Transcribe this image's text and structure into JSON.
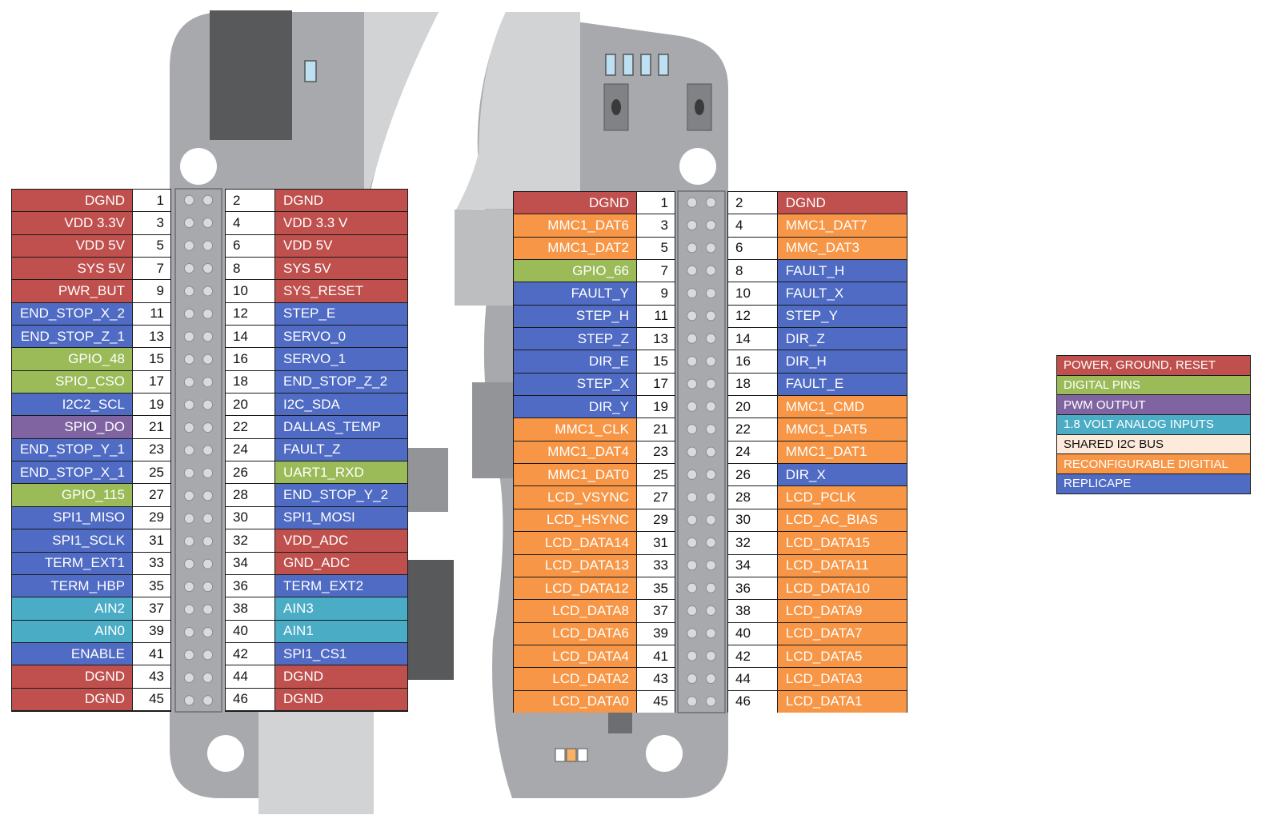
{
  "colors": {
    "power": "#c0504d",
    "digital": "#9bbb59",
    "pwm": "#8064a2",
    "analog": "#4bacc6",
    "i2c": "#fdeada",
    "reconfig": "#f79646",
    "replicape": "#4f6bc4"
  },
  "legend": [
    {
      "label": "POWER, GROUND, RESET",
      "cat": "power"
    },
    {
      "label": "DIGITAL PINS",
      "cat": "digital"
    },
    {
      "label": "PWM OUTPUT",
      "cat": "pwm"
    },
    {
      "label": "1.8 VOLT ANALOG INPUTS",
      "cat": "analog"
    },
    {
      "label": "SHARED I2C BUS",
      "cat": "i2c"
    },
    {
      "label": "RECONFIGURABLE DIGITIAL",
      "cat": "reconfig"
    },
    {
      "label": "REPLICAPE",
      "cat": "replicape"
    }
  ],
  "p9": {
    "odd": [
      {
        "label": "DGND",
        "pin": "1",
        "cat": "power"
      },
      {
        "label": "VDD 3.3V",
        "pin": "3",
        "cat": "power"
      },
      {
        "label": "VDD 5V",
        "pin": "5",
        "cat": "power"
      },
      {
        "label": "SYS 5V",
        "pin": "7",
        "cat": "power"
      },
      {
        "label": "PWR_BUT",
        "pin": "9",
        "cat": "power"
      },
      {
        "label": "END_STOP_X_2",
        "pin": "11",
        "cat": "replicape"
      },
      {
        "label": "END_STOP_Z_1",
        "pin": "13",
        "cat": "replicape"
      },
      {
        "label": "GPIO_48",
        "pin": "15",
        "cat": "digital"
      },
      {
        "label": "SPIO_CSO",
        "pin": "17",
        "cat": "digital"
      },
      {
        "label": "I2C2_SCL",
        "pin": "19",
        "cat": "replicape"
      },
      {
        "label": "SPIO_DO",
        "pin": "21",
        "cat": "pwm"
      },
      {
        "label": "END_STOP_Y_1",
        "pin": "23",
        "cat": "replicape"
      },
      {
        "label": "END_STOP_X_1",
        "pin": "25",
        "cat": "replicape"
      },
      {
        "label": "GPIO_115",
        "pin": "27",
        "cat": "digital"
      },
      {
        "label": "SPI1_MISO",
        "pin": "29",
        "cat": "replicape"
      },
      {
        "label": "SPI1_SCLK",
        "pin": "31",
        "cat": "replicape"
      },
      {
        "label": "TERM_EXT1",
        "pin": "33",
        "cat": "replicape"
      },
      {
        "label": "TERM_HBP",
        "pin": "35",
        "cat": "replicape"
      },
      {
        "label": "AIN2",
        "pin": "37",
        "cat": "analog"
      },
      {
        "label": "AIN0",
        "pin": "39",
        "cat": "analog"
      },
      {
        "label": "ENABLE",
        "pin": "41",
        "cat": "replicape"
      },
      {
        "label": "DGND",
        "pin": "43",
        "cat": "power"
      },
      {
        "label": "DGND",
        "pin": "45",
        "cat": "power"
      }
    ],
    "even": [
      {
        "label": "DGND",
        "pin": "2",
        "cat": "power"
      },
      {
        "label": "VDD 3.3 V",
        "pin": "4",
        "cat": "power"
      },
      {
        "label": "VDD 5V",
        "pin": "6",
        "cat": "power"
      },
      {
        "label": "SYS 5V",
        "pin": "8",
        "cat": "power"
      },
      {
        "label": "SYS_RESET",
        "pin": "10",
        "cat": "power"
      },
      {
        "label": "STEP_E",
        "pin": "12",
        "cat": "replicape"
      },
      {
        "label": "SERVO_0",
        "pin": "14",
        "cat": "replicape"
      },
      {
        "label": "SERVO_1",
        "pin": "16",
        "cat": "replicape"
      },
      {
        "label": "END_STOP_Z_2",
        "pin": "18",
        "cat": "replicape"
      },
      {
        "label": "I2C_SDA",
        "pin": "20",
        "cat": "replicape"
      },
      {
        "label": "DALLAS_TEMP",
        "pin": "22",
        "cat": "replicape"
      },
      {
        "label": "FAULT_Z",
        "pin": "24",
        "cat": "replicape"
      },
      {
        "label": "UART1_RXD",
        "pin": "26",
        "cat": "digital"
      },
      {
        "label": "END_STOP_Y_2",
        "pin": "28",
        "cat": "replicape"
      },
      {
        "label": "SPI1_MOSI",
        "pin": "30",
        "cat": "replicape"
      },
      {
        "label": "VDD_ADC",
        "pin": "32",
        "cat": "power"
      },
      {
        "label": "GND_ADC",
        "pin": "34",
        "cat": "power"
      },
      {
        "label": "TERM_EXT2",
        "pin": "36",
        "cat": "replicape"
      },
      {
        "label": "AIN3",
        "pin": "38",
        "cat": "analog"
      },
      {
        "label": "AIN1",
        "pin": "40",
        "cat": "analog"
      },
      {
        "label": "SPI1_CS1",
        "pin": "42",
        "cat": "replicape"
      },
      {
        "label": "DGND",
        "pin": "44",
        "cat": "power"
      },
      {
        "label": "DGND",
        "pin": "46",
        "cat": "power"
      }
    ]
  },
  "p8": {
    "odd": [
      {
        "label": "DGND",
        "pin": "1",
        "cat": "power"
      },
      {
        "label": "MMC1_DAT6",
        "pin": "3",
        "cat": "reconfig"
      },
      {
        "label": "MMC1_DAT2",
        "pin": "5",
        "cat": "reconfig"
      },
      {
        "label": "GPIO_66",
        "pin": "7",
        "cat": "digital"
      },
      {
        "label": "FAULT_Y",
        "pin": "9",
        "cat": "replicape"
      },
      {
        "label": "STEP_H",
        "pin": "11",
        "cat": "replicape"
      },
      {
        "label": "STEP_Z",
        "pin": "13",
        "cat": "replicape"
      },
      {
        "label": "DIR_E",
        "pin": "15",
        "cat": "replicape"
      },
      {
        "label": "STEP_X",
        "pin": "17",
        "cat": "replicape"
      },
      {
        "label": "DIR_Y",
        "pin": "19",
        "cat": "replicape"
      },
      {
        "label": "MMC1_CLK",
        "pin": "21",
        "cat": "reconfig"
      },
      {
        "label": "MMC1_DAT4",
        "pin": "23",
        "cat": "reconfig"
      },
      {
        "label": "MMC1_DAT0",
        "pin": "25",
        "cat": "reconfig"
      },
      {
        "label": "LCD_VSYNC",
        "pin": "27",
        "cat": "reconfig"
      },
      {
        "label": "LCD_HSYNC",
        "pin": "29",
        "cat": "reconfig"
      },
      {
        "label": "LCD_DATA14",
        "pin": "31",
        "cat": "reconfig"
      },
      {
        "label": "LCD_DATA13",
        "pin": "33",
        "cat": "reconfig"
      },
      {
        "label": "LCD_DATA12",
        "pin": "35",
        "cat": "reconfig"
      },
      {
        "label": "LCD_DATA8",
        "pin": "37",
        "cat": "reconfig"
      },
      {
        "label": "LCD_DATA6",
        "pin": "39",
        "cat": "reconfig"
      },
      {
        "label": "LCD_DATA4",
        "pin": "41",
        "cat": "reconfig"
      },
      {
        "label": "LCD_DATA2",
        "pin": "43",
        "cat": "reconfig"
      },
      {
        "label": "LCD_DATA0",
        "pin": "45",
        "cat": "reconfig"
      }
    ],
    "even": [
      {
        "label": "DGND",
        "pin": "2",
        "cat": "power"
      },
      {
        "label": "MMC1_DAT7",
        "pin": "4",
        "cat": "reconfig"
      },
      {
        "label": "MMC_DAT3",
        "pin": "6",
        "cat": "reconfig"
      },
      {
        "label": "FAULT_H",
        "pin": "8",
        "cat": "replicape"
      },
      {
        "label": "FAULT_X",
        "pin": "10",
        "cat": "replicape"
      },
      {
        "label": "STEP_Y",
        "pin": "12",
        "cat": "replicape"
      },
      {
        "label": "DIR_Z",
        "pin": "14",
        "cat": "replicape"
      },
      {
        "label": "DIR_H",
        "pin": "16",
        "cat": "replicape"
      },
      {
        "label": "FAULT_E",
        "pin": "18",
        "cat": "replicape"
      },
      {
        "label": "MMC1_CMD",
        "pin": "20",
        "cat": "reconfig"
      },
      {
        "label": "MMC1_DAT5",
        "pin": "22",
        "cat": "reconfig"
      },
      {
        "label": "MMC1_DAT1",
        "pin": "24",
        "cat": "reconfig"
      },
      {
        "label": "DIR_X",
        "pin": "26",
        "cat": "replicape"
      },
      {
        "label": "LCD_PCLK",
        "pin": "28",
        "cat": "reconfig"
      },
      {
        "label": "LCD_AC_BIAS",
        "pin": "30",
        "cat": "reconfig"
      },
      {
        "label": "LCD_DATA15",
        "pin": "32",
        "cat": "reconfig"
      },
      {
        "label": "LCD_DATA11",
        "pin": "34",
        "cat": "reconfig"
      },
      {
        "label": "LCD_DATA10",
        "pin": "36",
        "cat": "reconfig"
      },
      {
        "label": "LCD_DATA9",
        "pin": "38",
        "cat": "reconfig"
      },
      {
        "label": "LCD_DATA7",
        "pin": "40",
        "cat": "reconfig"
      },
      {
        "label": "LCD_DATA5",
        "pin": "42",
        "cat": "reconfig"
      },
      {
        "label": "LCD_DATA3",
        "pin": "44",
        "cat": "reconfig"
      },
      {
        "label": "LCD_DATA1",
        "pin": "46",
        "cat": "reconfig"
      }
    ]
  }
}
